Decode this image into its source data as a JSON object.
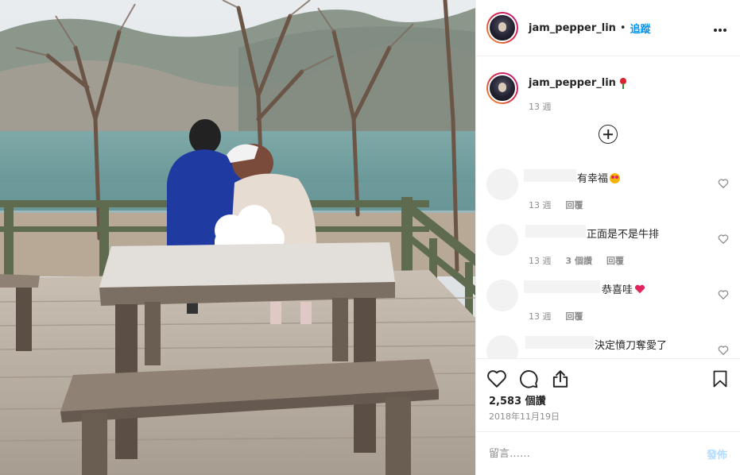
{
  "header": {
    "username": "jam_pepper_lin",
    "separator": "•",
    "follow_label": "追蹤",
    "more_label": "•••"
  },
  "caption": {
    "username": "jam_pepper_lin",
    "time": "13 週"
  },
  "comments": [
    {
      "text": "有幸福",
      "emoji": "heart-eyes",
      "time": "13 週",
      "reply_count": "",
      "reply_label": "回覆"
    },
    {
      "text": "正面是不是牛排",
      "emoji": "",
      "time": "13 週",
      "reply_count": "3 個讚",
      "reply_label": "回覆"
    },
    {
      "text": "恭喜哇",
      "emoji": "heart",
      "time": "13 週",
      "reply_count": "",
      "reply_label": "回覆"
    },
    {
      "text": "決定憤刀奪愛了",
      "emoji": "",
      "time": "",
      "reply_count": "",
      "reply_label": ""
    }
  ],
  "stats": {
    "views": "2,583 個讚",
    "date": "2018年11月19日"
  },
  "add_comment": {
    "placeholder": "留言……",
    "post_label": "發佈"
  },
  "colors": {
    "accent": "#0095f6",
    "muted": "#8e8e8e",
    "post_disabled": "#b3dbff"
  },
  "icons": [
    "more-icon",
    "heart-icon",
    "comment-icon",
    "share-icon",
    "bookmark-icon",
    "load-more-icon"
  ]
}
